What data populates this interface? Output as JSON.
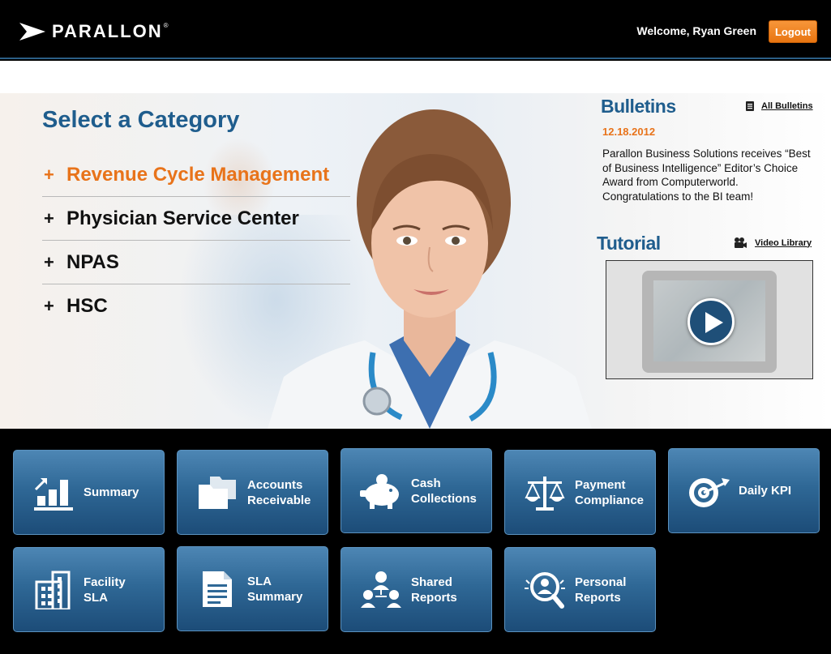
{
  "header": {
    "brand": "PARALLON",
    "brand_mark": "®",
    "welcome": "Welcome, Ryan Green",
    "logout_label": "Logout"
  },
  "categories": {
    "title": "Select a Category",
    "items": [
      {
        "label": "Revenue Cycle Management",
        "active": true
      },
      {
        "label": "Physician Service Center",
        "active": false
      },
      {
        "label": "NPAS",
        "active": false
      },
      {
        "label": "HSC",
        "active": false
      }
    ],
    "expand_symbol": "+"
  },
  "bulletins": {
    "title": "Bulletins",
    "link_label": "All Bulletins",
    "link_icon": "document-icon",
    "date": "12.18.2012",
    "text": "Parallon Business Solutions receives “Best of Business Intelligence” Editor’s Choice Award from Computerworld. Congratulations to the BI team!"
  },
  "tutorial": {
    "title": "Tutorial",
    "link_label": "Video Library",
    "link_icon": "camera-icon"
  },
  "tiles": [
    {
      "label": "Summary",
      "icon": "bar-chart-icon"
    },
    {
      "label": "Accounts\nReceivable",
      "icon": "folders-icon"
    },
    {
      "label": "Cash\nCollections",
      "icon": "piggy-bank-icon"
    },
    {
      "label": "Payment\nCompliance",
      "icon": "scales-icon"
    },
    {
      "label": "Daily KPI",
      "icon": "target-icon"
    },
    {
      "label": "Facility\nSLA",
      "icon": "building-icon"
    },
    {
      "label": "SLA\nSummary",
      "icon": "document-icon"
    },
    {
      "label": "Shared\nReports",
      "icon": "team-icon"
    },
    {
      "label": "Personal\nReports",
      "icon": "person-search-icon"
    }
  ],
  "colors": {
    "accent_orange": "#e8731a",
    "title_blue": "#1f5d8d",
    "tile_blue": "#2f6896"
  }
}
